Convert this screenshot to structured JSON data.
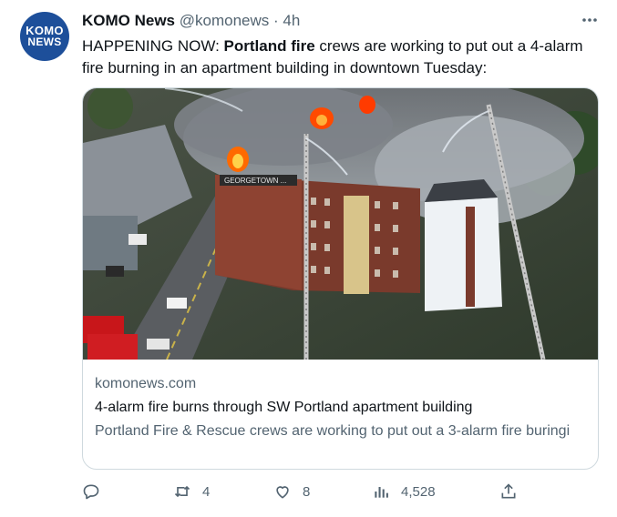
{
  "user": {
    "avatar_line1": "KOMO",
    "avatar_line2": "NEWS",
    "name": "KOMO News",
    "handle": "@komonews",
    "separator": "·",
    "time": "4h"
  },
  "tweet": {
    "prefix": "HAPPENING NOW: ",
    "bold": "Portland fire",
    "rest": " crews are working to put out a 4-alarm fire burning in an apartment building in downtown Tuesday:"
  },
  "card": {
    "domain": "komonews.com",
    "title": "4-alarm fire burns through SW Portland apartment building",
    "description": "Portland Fire & Rescue crews are working to put out a 3-alarm fire buringi",
    "building_sign": "GEORGETOWN ..."
  },
  "actions": {
    "reply_count": "",
    "retweet_count": "4",
    "like_count": "8",
    "views_count": "4,528"
  },
  "colors": {
    "accent": "#1d9bf0",
    "text": "#0f1419",
    "muted": "#536471",
    "border": "#cfd9de",
    "avatar_bg": "#1d4f9a"
  }
}
